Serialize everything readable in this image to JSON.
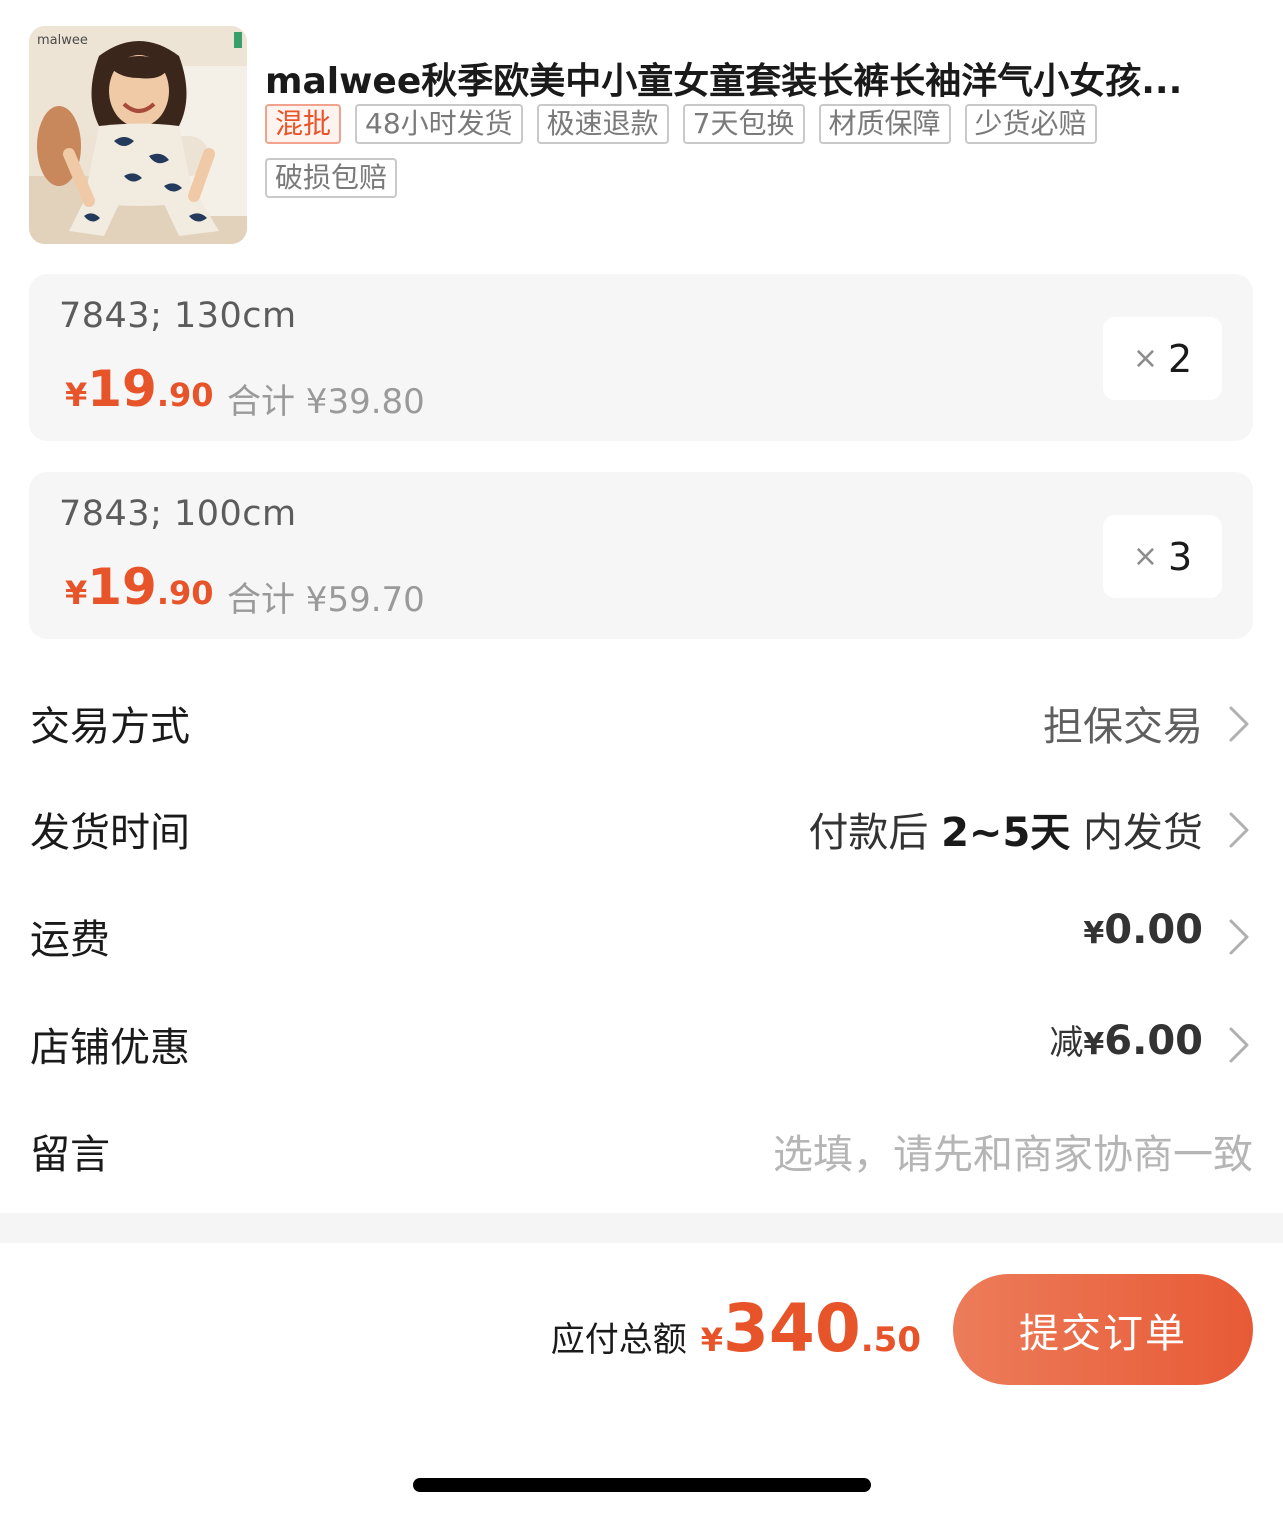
{
  "product": {
    "title": "malwee秋季欧美中小童女童套装长裤长袖洋气小女孩...",
    "thumb_text": "malwee",
    "tags": [
      {
        "label": "混批",
        "style": "hot"
      },
      {
        "label": "48小时发货",
        "style": "normal"
      },
      {
        "label": "极速退款",
        "style": "normal"
      },
      {
        "label": "7天包换",
        "style": "normal"
      },
      {
        "label": "材质保障",
        "style": "normal"
      },
      {
        "label": "少货必赔",
        "style": "normal"
      },
      {
        "label": "破损包赔",
        "style": "normal"
      }
    ]
  },
  "skus": [
    {
      "spec": "7843;  130cm",
      "currency": "¥",
      "price_int": "19",
      "price_dec": ".90",
      "subtotal": "合计 ¥39.80",
      "qty_symbol": "×",
      "qty": "2"
    },
    {
      "spec": "7843;  100cm",
      "currency": "¥",
      "price_int": "19",
      "price_dec": ".90",
      "subtotal": "合计 ¥59.70",
      "qty_symbol": "×",
      "qty": "3"
    }
  ],
  "rows": {
    "trade": {
      "label": "交易方式",
      "value": "担保交易"
    },
    "delivery": {
      "label": "发货时间",
      "prefix": "付款后 ",
      "days": "2~5天",
      "suffix": " 内发货"
    },
    "shipping": {
      "label": "运费",
      "currency": "¥",
      "amount": "0.00"
    },
    "coupon": {
      "label": "店铺优惠",
      "prefix": "减",
      "currency": "¥",
      "amount": "6.00"
    },
    "note": {
      "label": "留言",
      "placeholder": "选填，请先和商家协商一致"
    }
  },
  "footer": {
    "total_label": "应付总额",
    "currency": "¥",
    "total_int": "340",
    "total_dec": ".50",
    "submit_label": "提交订单"
  },
  "colors": {
    "accent": "#e8542a",
    "card_bg": "#f6f6f6"
  }
}
